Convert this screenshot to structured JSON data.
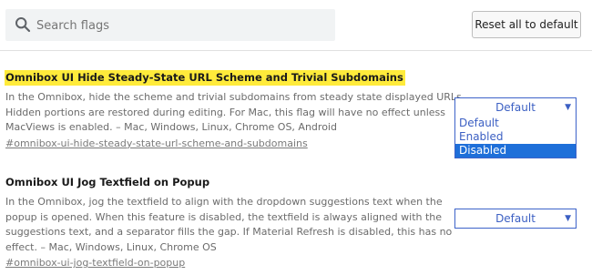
{
  "search": {
    "placeholder": "Search flags"
  },
  "toolbar": {
    "reset_label": "Reset all to default"
  },
  "flags": [
    {
      "title": "Omnibox UI Hide Steady-State URL Scheme and Trivial Subdomains",
      "description_lines": [
        "In the Omnibox, hide the scheme and trivial subdomains from steady state displayed URLs.",
        "Hidden portions are restored during editing. For Mac, this flag will have no effect unless",
        "MacViews is enabled. – Mac, Windows, Linux, Chrome OS, Android"
      ],
      "link": "#omnibox-ui-hide-steady-state-url-scheme-and-subdomains",
      "select_value": "Default",
      "options": [
        "Default",
        "Enabled",
        "Disabled"
      ],
      "highlighted_option": "Disabled"
    },
    {
      "title": "Omnibox UI Jog Textfield on Popup",
      "description_lines": [
        "In the Omnibox, jog the textfield to align with the dropdown suggestions text when the",
        "popup is opened. When this feature is disabled, the textfield is always aligned with the",
        "suggestions text, and a separator fills the gap. If Material Refresh is disabled, this has no",
        "effect. – Mac, Windows, Linux, Chrome OS"
      ],
      "link": "#omnibox-ui-jog-textfield-on-popup",
      "select_value": "Default"
    }
  ],
  "icons": {
    "search": "search-icon",
    "dropdown_arrow": "▼"
  },
  "colors": {
    "highlight": "#ffeb3b",
    "select_accent": "#3b5fc3",
    "selected_option_bg": "#1e6fd9"
  }
}
